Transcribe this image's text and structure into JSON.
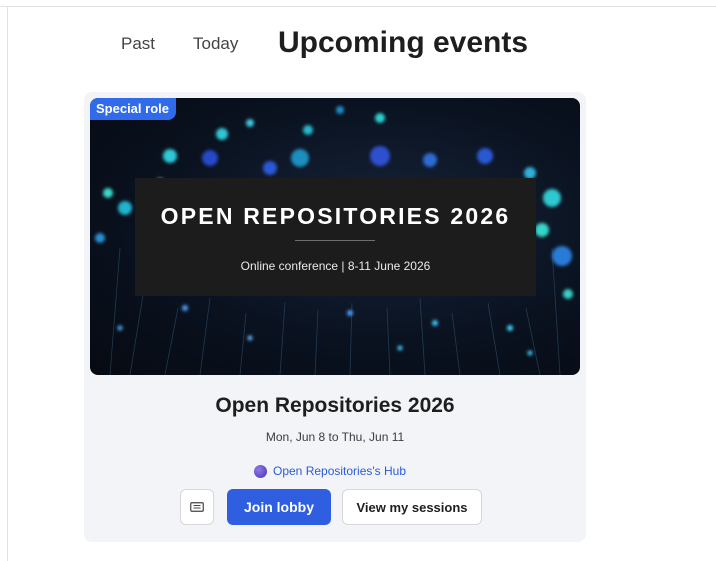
{
  "tabs": {
    "past": "Past",
    "today": "Today",
    "upcoming": "Upcoming events"
  },
  "event": {
    "badge": "Special role",
    "banner_title": "OPEN REPOSITORIES 2026",
    "banner_subtitle": "Online conference | 8-11 June 2026",
    "name": "Open Repositories 2026",
    "dates": "Mon, Jun 8 to Thu, Jun 11",
    "hub": "Open Repositories's Hub"
  },
  "actions": {
    "ticket_icon": "ticket-icon",
    "join": "Join lobby",
    "sessions": "View my sessions"
  },
  "colors": {
    "accent": "#2f5fe0",
    "badge": "#2f6bea",
    "link": "#2a5bd7",
    "card": "#f3f4f8"
  }
}
